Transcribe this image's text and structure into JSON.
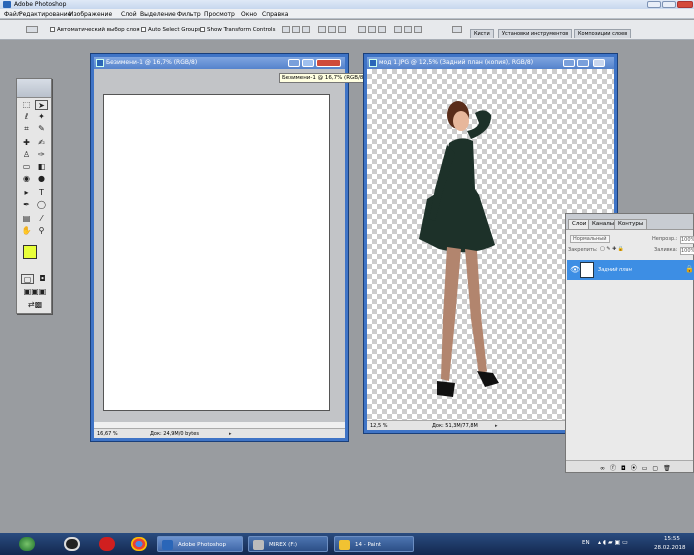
{
  "app": {
    "title": "Adobe Photoshop"
  },
  "menu": [
    "Файл",
    "Редактирование",
    "Изображение",
    "Слой",
    "Выделение",
    "Фильтр",
    "Просмотр",
    "Окно",
    "Справка"
  ],
  "options": {
    "auto_select_label": "Автоматический выбор слоя",
    "auto_select_groups": "Auto Select Groups",
    "show_transform": "Show Transform Controls",
    "palette_tabs": [
      "Кисти",
      "Установки инструментов",
      "Композиции слоев"
    ]
  },
  "doc1": {
    "title": "Безимени-1 @ 16,7% (RGB/8)",
    "zoom": "16,67 %",
    "info": "Док: 24,9M/0 bytes"
  },
  "doc2": {
    "title": "мод 1.JPG @ 12,5% (Задний план (копия), RGB/8)",
    "zoom": "12,5 %",
    "info": "Док: 51,3M/77,8M"
  },
  "tooltip": "Безимени-1 @ 16,7% (RGB/8)",
  "layers": {
    "tabs": [
      "Слои",
      "Каналы",
      "Контуры"
    ],
    "blend_mode": "Нормальный",
    "opacity_label": "Непрозр.:",
    "opacity_value": "100%",
    "lock_label": "Закрепить:",
    "fill_label": "Заливка:",
    "fill_value": "100%",
    "layer_name": "Задний план"
  },
  "taskbar": {
    "buttons": [
      "Adobe Photoshop",
      "MIREX (F:)",
      "14 - Paint"
    ],
    "lang": "EN",
    "time": "15:55",
    "date": "28.02.2018"
  },
  "colors": {
    "foreground": "#e8ff3a",
    "background": "#7ac700",
    "title_blue": "#3f74c6",
    "layer_selected": "#3d8ee4"
  }
}
